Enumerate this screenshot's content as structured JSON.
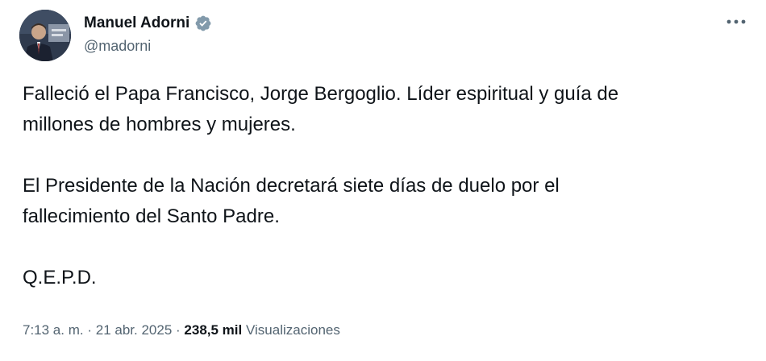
{
  "tweet": {
    "author": {
      "display_name": "Manuel Adorni",
      "handle": "@madorni",
      "verified": true
    },
    "paragraphs": [
      "Falleció el Papa Francisco, Jorge Bergoglio. Líder espiritual y guía de\nmillones de hombres y mujeres.",
      "El Presidente de la Nación decretará siete días de duelo por el\nfallecimiento del Santo Padre.",
      "Q.E.P.D."
    ],
    "meta": {
      "time": "7:13 a. m.",
      "separator": "·",
      "date": "21 abr. 2025",
      "views_count": "238,5 mil",
      "views_label": "Visualizaciones"
    }
  },
  "icons": {
    "verified": "verified-badge-icon",
    "more": "more-dots-icon"
  },
  "colors": {
    "text_primary": "#0f1419",
    "text_secondary": "#536471",
    "verified_badge": "#829aab",
    "background": "#ffffff"
  }
}
